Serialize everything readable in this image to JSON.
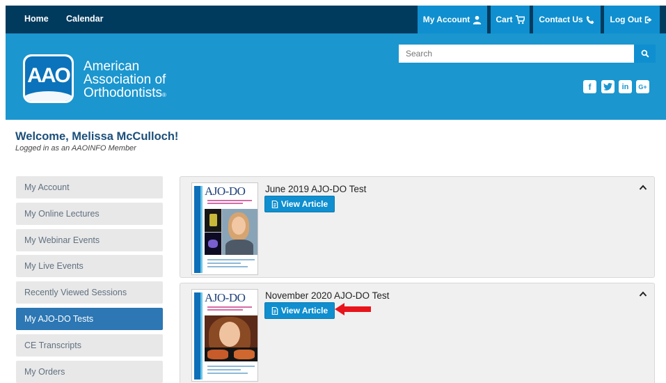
{
  "topnav": {
    "home": "Home",
    "calendar": "Calendar",
    "my_account": "My Account",
    "cart": "Cart",
    "contact": "Contact Us",
    "logout": "Log Out"
  },
  "header": {
    "logo_text": "AAO",
    "org_line1": "American",
    "org_line2": "Association of",
    "org_line3": "Orthodontists",
    "reg_mark": "®",
    "search_placeholder": "Search",
    "social": [
      "facebook-icon",
      "twitter-icon",
      "linkedin-icon",
      "google-plus-icon"
    ]
  },
  "welcome": {
    "title": "Welcome, Melissa McCulloch!",
    "subtitle": "Logged in as an AAOINFO Member"
  },
  "sidebar": {
    "items": [
      {
        "label": "My Account"
      },
      {
        "label": "My Online Lectures"
      },
      {
        "label": "My Webinar Events"
      },
      {
        "label": "My Live Events"
      },
      {
        "label": "Recently Viewed Sessions"
      },
      {
        "label": "My AJO-DO Tests",
        "active": true
      },
      {
        "label": "CE Transcripts"
      },
      {
        "label": "My Orders"
      }
    ]
  },
  "tests": [
    {
      "title": "June 2019 AJO-DO Test",
      "button": "View Article",
      "cover_masthead": "AJO-DO"
    },
    {
      "title": "November 2020 AJO-DO Test",
      "button": "View Article",
      "cover_masthead": "AJO-DO"
    }
  ],
  "colors": {
    "navy": "#003a5d",
    "brand_blue": "#1b96cf",
    "button_blue": "#0f8fcf",
    "active_sidebar": "#2c77b4",
    "annotation_arrow": "#e8141b"
  }
}
